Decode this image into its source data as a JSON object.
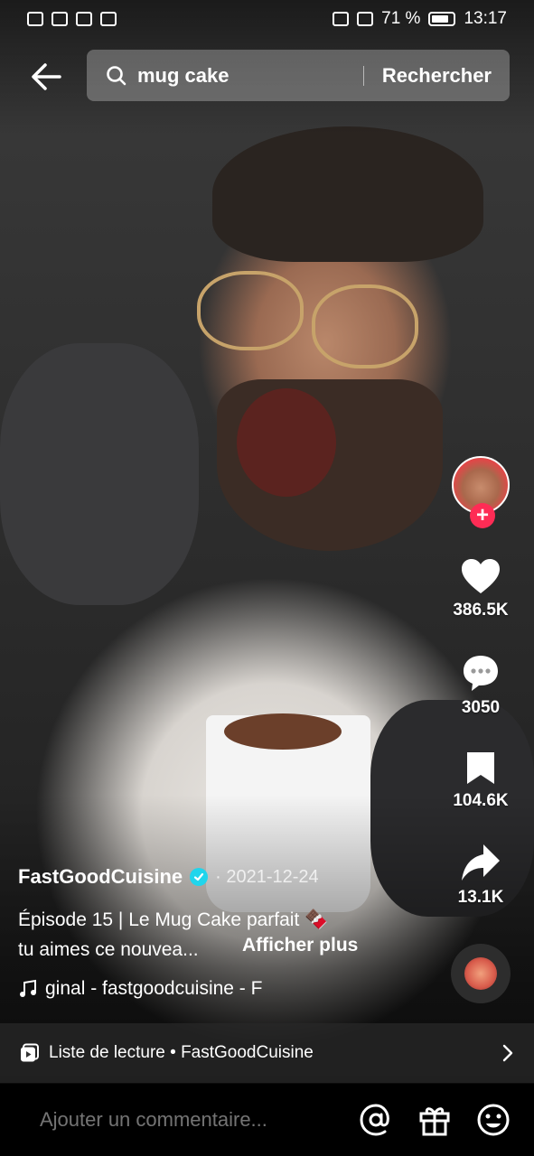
{
  "status_bar": {
    "battery": "71 %",
    "time": "13:17"
  },
  "search": {
    "query": "mug cake",
    "button": "Rechercher"
  },
  "video": {
    "author": "FastGoodCuisine",
    "date": "· 2021-12-24",
    "desc_line1": "Épisode 15 | Le Mug Cake parfait 🍫",
    "desc_line2": "tu aimes ce nouvea...",
    "more": "Afficher plus",
    "music": "ginal - fastgoodcuisine - F"
  },
  "actions": {
    "likes": "386.5K",
    "comments": "3050",
    "saves": "104.6K",
    "shares": "13.1K"
  },
  "playlist": {
    "label": "Liste de lecture • FastGoodCuisine"
  },
  "comment_bar": {
    "placeholder": "Ajouter un commentaire..."
  },
  "icons": [
    "back-arrow-icon",
    "search-icon",
    "heart-icon",
    "comment-icon",
    "bookmark-icon",
    "share-icon",
    "music-note-icon",
    "playlist-icon",
    "chevron-right-icon",
    "mention-icon",
    "gift-icon",
    "emoji-icon",
    "verified-icon",
    "plus-icon"
  ],
  "colors": {
    "accent_pink": "#fe2c55",
    "verified_blue": "#20d5ec"
  }
}
